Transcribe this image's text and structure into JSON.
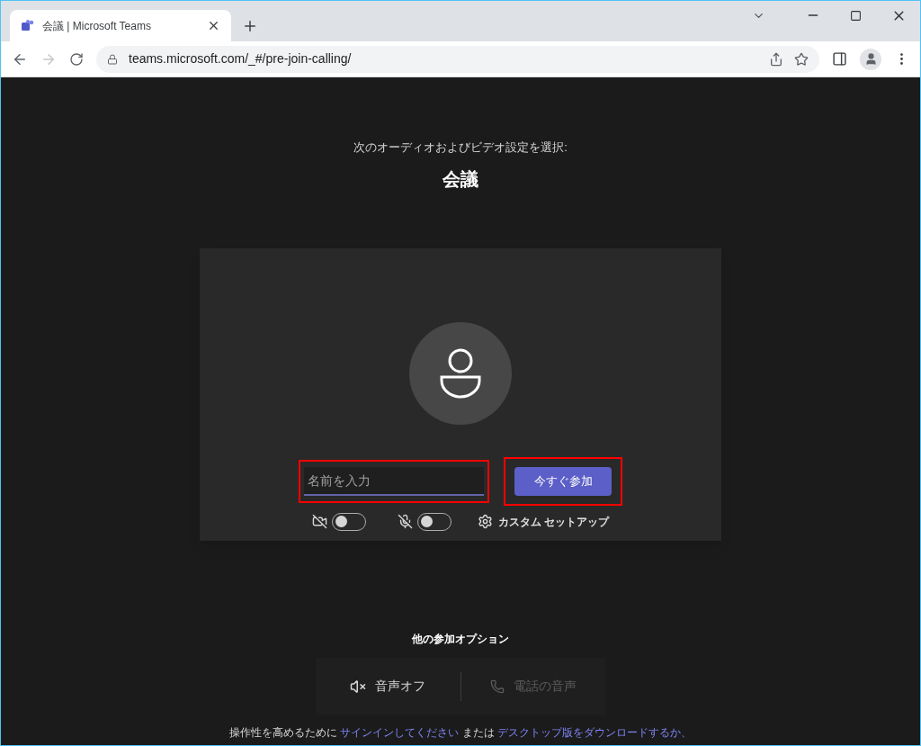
{
  "browser": {
    "tab_title": "会議 | Microsoft Teams",
    "url": "teams.microsoft.com/_#/pre-join-calling/"
  },
  "prejoin": {
    "subtitle": "次のオーディオおよびビデオ設定を選択:",
    "title": "会議",
    "name_field": {
      "placeholder": "名前を入力",
      "highlighted": true
    },
    "join_button": {
      "label": "今すぐ参加",
      "highlighted": true
    },
    "camera": {
      "on": false
    },
    "microphone": {
      "on": false
    },
    "custom_setup": "カスタム セットアップ"
  },
  "other_options": {
    "title": "他の参加オプション",
    "options": [
      {
        "label": "音声オフ",
        "kind": "audio-off",
        "disabled": false
      },
      {
        "label": "電話の音声",
        "kind": "phone",
        "disabled": true
      }
    ]
  },
  "footer": {
    "text_1": "操作性を高めるために",
    "link_1": "サインインしてください",
    "text_2": "または",
    "link_2": "デスクトップ版をダウンロードするか、"
  }
}
